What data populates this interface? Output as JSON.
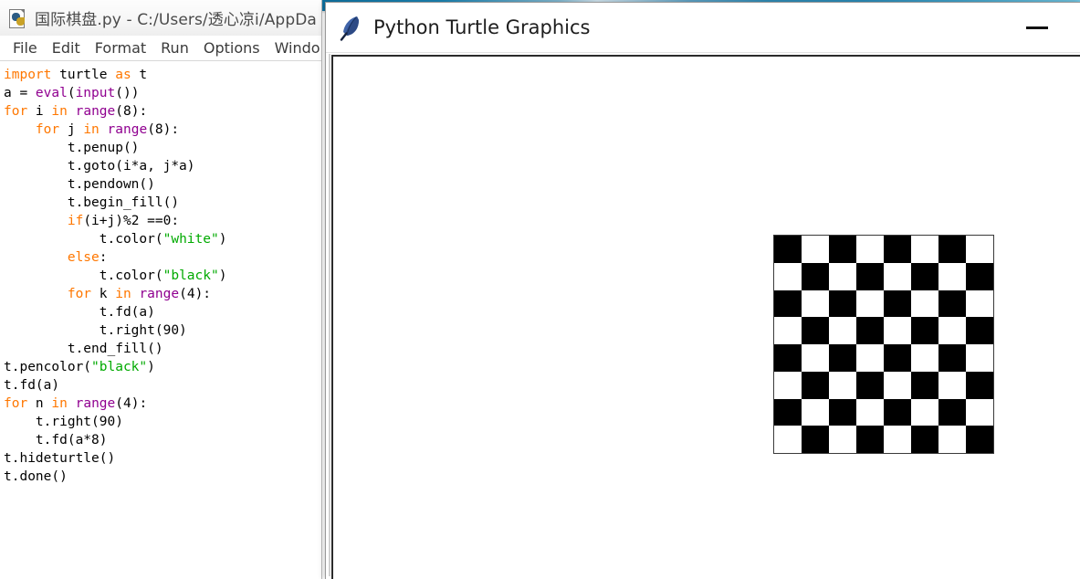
{
  "desktop": {
    "wallpaper_colors": [
      "#0d6f9e",
      "#2f8ab4",
      "#6ec0dc"
    ]
  },
  "idle_window": {
    "icon": "python-file-icon",
    "title": "国际棋盘.py - C:/Users/透心凉i/AppDa",
    "menu": [
      {
        "label": "File"
      },
      {
        "label": "Edit"
      },
      {
        "label": "Format"
      },
      {
        "label": "Run"
      },
      {
        "label": "Options"
      },
      {
        "label": "Windo"
      }
    ],
    "code_lines": [
      [
        {
          "t": "import",
          "c": "kw"
        },
        {
          "t": " turtle ",
          "c": "plain"
        },
        {
          "t": "as",
          "c": "kw"
        },
        {
          "t": " t",
          "c": "plain"
        }
      ],
      [
        {
          "t": "a = ",
          "c": "plain"
        },
        {
          "t": "eval",
          "c": "builtin"
        },
        {
          "t": "(",
          "c": "plain"
        },
        {
          "t": "input",
          "c": "builtin"
        },
        {
          "t": "())",
          "c": "plain"
        }
      ],
      [
        {
          "t": "for",
          "c": "kw"
        },
        {
          "t": " i ",
          "c": "plain"
        },
        {
          "t": "in",
          "c": "kw"
        },
        {
          "t": " ",
          "c": "plain"
        },
        {
          "t": "range",
          "c": "builtin"
        },
        {
          "t": "(8):",
          "c": "plain"
        }
      ],
      [
        {
          "t": "    ",
          "c": "plain"
        },
        {
          "t": "for",
          "c": "kw"
        },
        {
          "t": " j ",
          "c": "plain"
        },
        {
          "t": "in",
          "c": "kw"
        },
        {
          "t": " ",
          "c": "plain"
        },
        {
          "t": "range",
          "c": "builtin"
        },
        {
          "t": "(8):",
          "c": "plain"
        }
      ],
      [
        {
          "t": "        t.penup()",
          "c": "plain"
        }
      ],
      [
        {
          "t": "        t.goto(i*a, j*a)",
          "c": "plain"
        }
      ],
      [
        {
          "t": "        t.pendown()",
          "c": "plain"
        }
      ],
      [
        {
          "t": "        t.begin_fill()",
          "c": "plain"
        }
      ],
      [
        {
          "t": "        ",
          "c": "plain"
        },
        {
          "t": "if",
          "c": "kw"
        },
        {
          "t": "(i+j)%2 ==0:",
          "c": "plain"
        }
      ],
      [
        {
          "t": "            t.color(",
          "c": "plain"
        },
        {
          "t": "\"white\"",
          "c": "str"
        },
        {
          "t": ")",
          "c": "plain"
        }
      ],
      [
        {
          "t": "        ",
          "c": "plain"
        },
        {
          "t": "else",
          "c": "kw"
        },
        {
          "t": ":",
          "c": "plain"
        }
      ],
      [
        {
          "t": "            t.color(",
          "c": "plain"
        },
        {
          "t": "\"black\"",
          "c": "str"
        },
        {
          "t": ")",
          "c": "plain"
        }
      ],
      [
        {
          "t": "        ",
          "c": "plain"
        },
        {
          "t": "for",
          "c": "kw"
        },
        {
          "t": " k ",
          "c": "plain"
        },
        {
          "t": "in",
          "c": "kw"
        },
        {
          "t": " ",
          "c": "plain"
        },
        {
          "t": "range",
          "c": "builtin"
        },
        {
          "t": "(4):",
          "c": "plain"
        }
      ],
      [
        {
          "t": "            t.fd(a)",
          "c": "plain"
        }
      ],
      [
        {
          "t": "            t.right(90)",
          "c": "plain"
        }
      ],
      [
        {
          "t": "        t.end_fill()",
          "c": "plain"
        }
      ],
      [
        {
          "t": "t.pencolor(",
          "c": "plain"
        },
        {
          "t": "\"black\"",
          "c": "str"
        },
        {
          "t": ")",
          "c": "plain"
        }
      ],
      [
        {
          "t": "t.fd(a)",
          "c": "plain"
        }
      ],
      [
        {
          "t": "for",
          "c": "kw"
        },
        {
          "t": " n ",
          "c": "plain"
        },
        {
          "t": "in",
          "c": "kw"
        },
        {
          "t": " ",
          "c": "plain"
        },
        {
          "t": "range",
          "c": "builtin"
        },
        {
          "t": "(4):",
          "c": "plain"
        }
      ],
      [
        {
          "t": "    t.right(90)",
          "c": "plain"
        }
      ],
      [
        {
          "t": "    t.fd(a*8)",
          "c": "plain"
        }
      ],
      [
        {
          "t": "t.hideturtle()",
          "c": "plain"
        }
      ],
      [
        {
          "t": "t.done()",
          "c": "plain"
        }
      ]
    ],
    "syntax_colors": {
      "keyword": "#ff7700",
      "builtin": "#900090",
      "string": "#00aa00",
      "plain": "#000000"
    }
  },
  "turtle_window": {
    "icon": "feather-icon",
    "title": "Python Turtle Graphics",
    "minimize_label": "minimize",
    "drawing": {
      "type": "checkerboard",
      "rows": 8,
      "columns": 8,
      "top_left_color": "black",
      "colors": {
        "dark": "#000000",
        "light": "#ffffff"
      },
      "border_color": "#3a3a3a"
    }
  }
}
